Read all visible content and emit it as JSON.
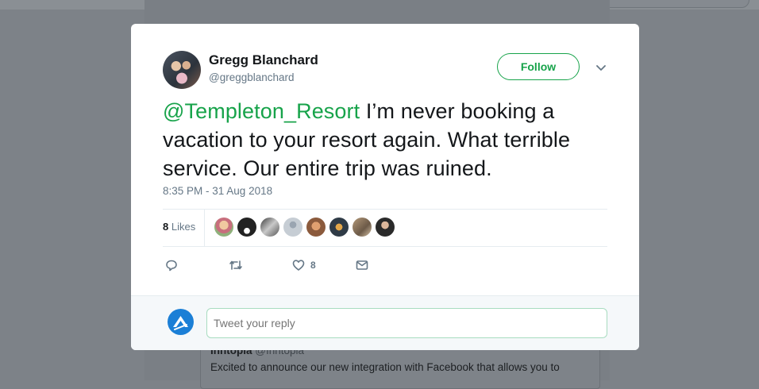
{
  "background": {
    "card_name": "Inntopia",
    "card_handle": "@Inntopia",
    "card_text_line1": "Excited to announce our new integration with Facebook that allows you to"
  },
  "tweet": {
    "author_name": "Gregg Blanchard",
    "author_handle": "@greggblanchard",
    "follow_label": "Follow",
    "mention": "@Templeton_Resort",
    "text": " I’m never booking a vacation to your resort again. What terrible service. Our entire trip was ruined.",
    "timestamp": "8:35 PM - 31 Aug 2018",
    "likes_number": "8",
    "likes_label": "Likes",
    "liker_avatars": [
      "avatar-1",
      "avatar-2",
      "avatar-3",
      "avatar-4",
      "avatar-5",
      "avatar-6",
      "avatar-7",
      "avatar-8"
    ],
    "actions": {
      "reply_icon": "reply-icon",
      "retweet_icon": "retweet-icon",
      "like_icon": "heart-icon",
      "like_count": "8",
      "message_icon": "envelope-icon"
    }
  },
  "reply": {
    "placeholder": "Tweet your reply"
  },
  "colors": {
    "accent": "#17a34a",
    "overlay": "#7d8288",
    "muted": "#657786",
    "text": "#14171a"
  }
}
